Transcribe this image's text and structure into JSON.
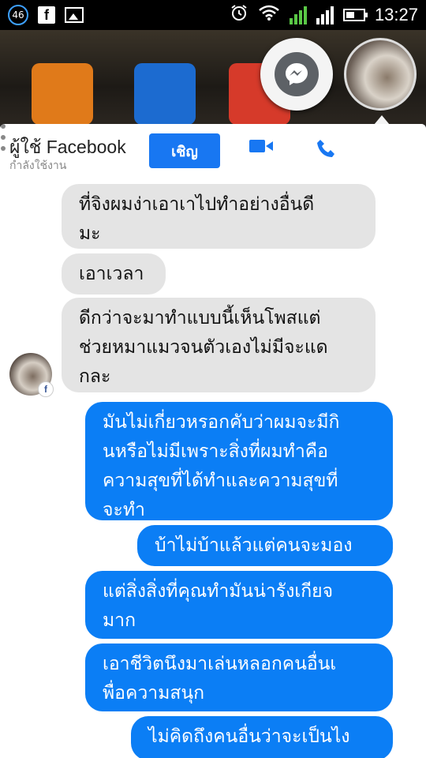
{
  "status_bar": {
    "notification_count": "46",
    "time": "13:27"
  },
  "chat_header": {
    "contact_name": "ผู้ใช้ Facebook",
    "status": "กำลังใช้งาน",
    "invite_label": "เชิญ"
  },
  "messages": [
    {
      "side": "in",
      "text": "ที่จิงผมง่าเอาเาไปทำอย่างอื่นดี\nมะ"
    },
    {
      "side": "in",
      "text": "เอาเวลา"
    },
    {
      "side": "in",
      "text": "ดีกว่าจะมาทำแบบนี้เห็นโพสแต่\nช่วยหมาแมวจนตัวเองไม่มีจะแด\nกละ"
    },
    {
      "side": "out",
      "text": "มันไม่เกี่ยวหรอกคับว่าผมจะมีกิ\nนหรือไม่มีเพราะสิ่งที่ผมทำคือ\nความสุขที่ได้ทำและความสุขที่\nจะทำ"
    },
    {
      "side": "out",
      "text": "บ้าไม่บ้าแล้วแต่คนจะมอง"
    },
    {
      "side": "out",
      "text": "แต่สิ่งสิ่งที่คุณทำมันน่ารังเกียจ\nมาก"
    },
    {
      "side": "out",
      "text": "เอาชีวิตนึงมาเล่นหลอกคนอื่นเ\nพื่อความสนุก"
    },
    {
      "side": "out",
      "text": "ไม่คิดถึงคนอื่นว่าจะเป็นไง"
    }
  ],
  "icons": {
    "facebook": "f",
    "avatar_badge": "f"
  },
  "colors": {
    "accent": "#1877f2",
    "outgoing_bubble": "#0b7ef5",
    "incoming_bubble": "#e4e4e4"
  }
}
